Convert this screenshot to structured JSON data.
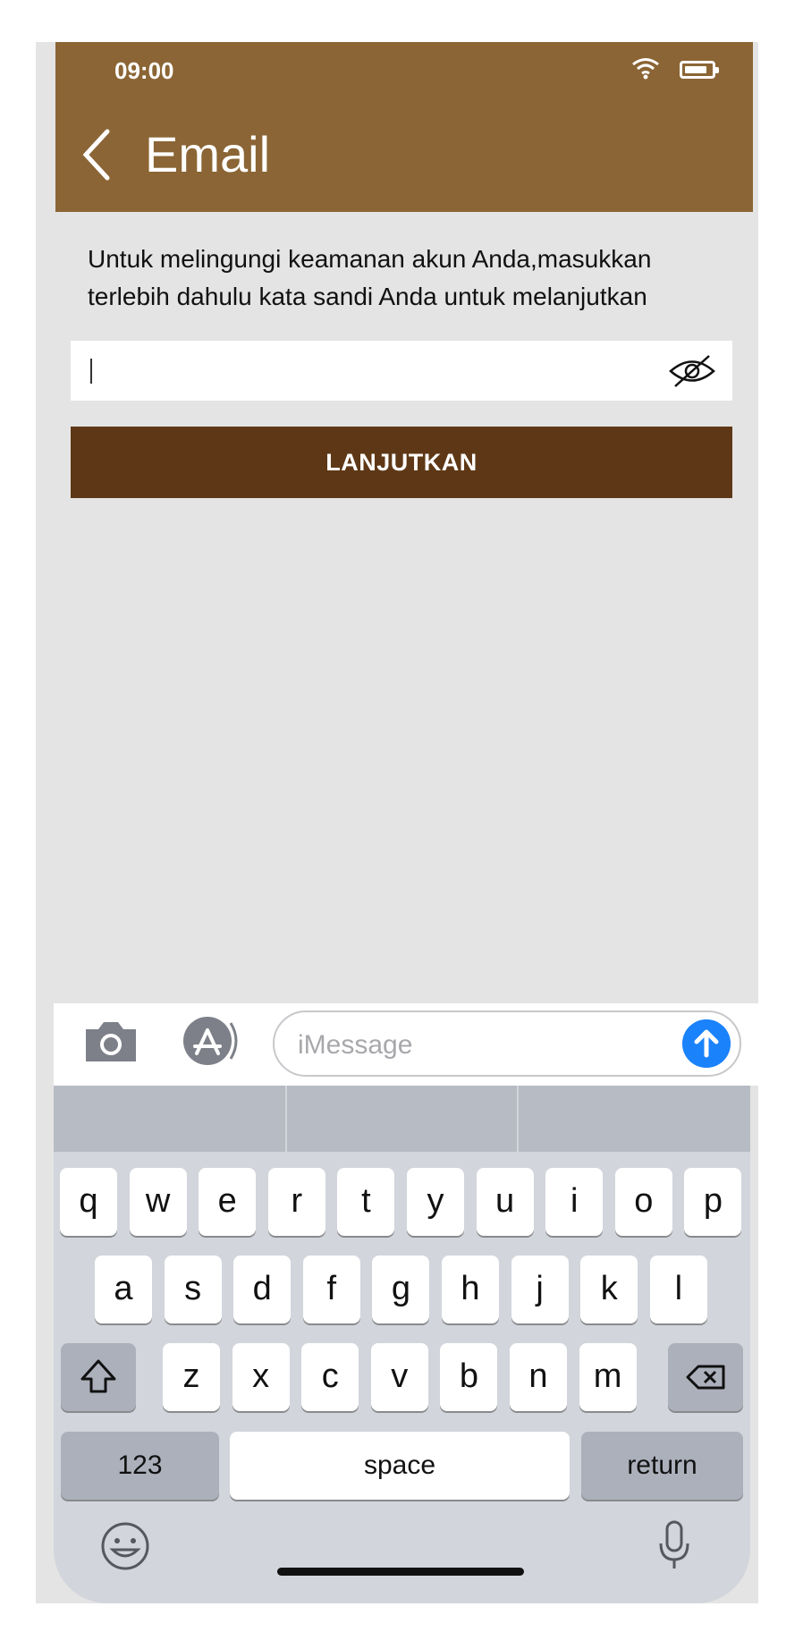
{
  "status_bar": {
    "time": "09:00"
  },
  "header": {
    "title": "Email"
  },
  "prompt": {
    "text": "Untuk melingungi keamanan akun Anda,masukkan terlebih dahulu kata sandi Anda untuk melanjutkan"
  },
  "password_field": {
    "value": ""
  },
  "continue_button": {
    "label": "LANJUTKAN"
  },
  "message_bar": {
    "placeholder": "iMessage"
  },
  "keyboard": {
    "row1": [
      "q",
      "w",
      "e",
      "r",
      "t",
      "y",
      "u",
      "i",
      "o",
      "p"
    ],
    "row2": [
      "a",
      "s",
      "d",
      "f",
      "g",
      "h",
      "j",
      "k",
      "l"
    ],
    "row3": [
      "z",
      "x",
      "c",
      "v",
      "b",
      "n",
      "m"
    ],
    "numbers_label": "123",
    "space_label": "space",
    "return_label": "return"
  },
  "colors": {
    "header": "#8b6535",
    "button": "#5e3816",
    "send": "#1a82fb"
  }
}
